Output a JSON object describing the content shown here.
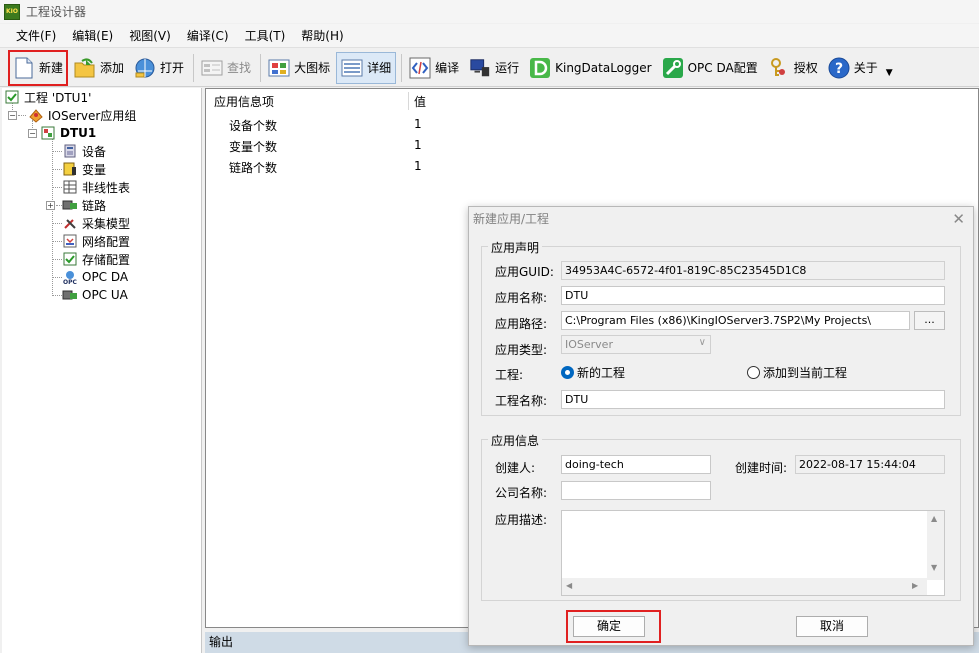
{
  "window": {
    "title": "工程设计器",
    "icon_text": "KIO"
  },
  "menu": [
    "文件(F)",
    "编辑(E)",
    "视图(V)",
    "编译(C)",
    "工具(T)",
    "帮助(H)"
  ],
  "toolbar": {
    "new": "新建",
    "add": "添加",
    "open": "打开",
    "find": "查找",
    "large_icons": "大图标",
    "details": "详细",
    "compile": "编译",
    "run": "运行",
    "kingdatalogger": "KingDataLogger",
    "opcda_config": "OPC DA配置",
    "authorize": "授权",
    "about": "关于"
  },
  "tree": {
    "project": "工程 'DTU1'",
    "group": "IOServer应用组",
    "app": "DTU1",
    "children": [
      "设备",
      "变量",
      "非线性表",
      "链路",
      "采集模型",
      "网络配置",
      "存储配置",
      "OPC DA",
      "OPC UA"
    ]
  },
  "info": {
    "headers": [
      "应用信息项",
      "值"
    ],
    "rows": [
      {
        "name": "设备个数",
        "value": "1"
      },
      {
        "name": "变量个数",
        "value": "1"
      },
      {
        "name": "链路个数",
        "value": "1"
      }
    ]
  },
  "output_label": "输出",
  "dialog": {
    "title": "新建应用/工程",
    "group_declaration": "应用声明",
    "guid_label": "应用GUID:",
    "guid_value": "34953A4C-6572-4f01-819C-85C23545D1C8",
    "name_label": "应用名称:",
    "name_value": "DTU",
    "path_label": "应用路径:",
    "path_value": "C:\\Program Files (x86)\\KingIOServer3.7SP2\\My Projects\\",
    "browse_label": "...",
    "type_label": "应用类型:",
    "type_value": "IOServer",
    "project_label": "工程:",
    "radio_new": "新的工程",
    "radio_add": "添加到当前工程",
    "project_name_label": "工程名称:",
    "project_name_value": "DTU",
    "group_info": "应用信息",
    "creator_label": "创建人:",
    "creator_value": "doing-tech",
    "created_time_label": "创建时间:",
    "created_time_value": "2022-08-17 15:44:04",
    "company_label": "公司名称:",
    "company_value": "",
    "desc_label": "应用描述:",
    "desc_value": "",
    "ok": "确定",
    "cancel": "取消"
  }
}
